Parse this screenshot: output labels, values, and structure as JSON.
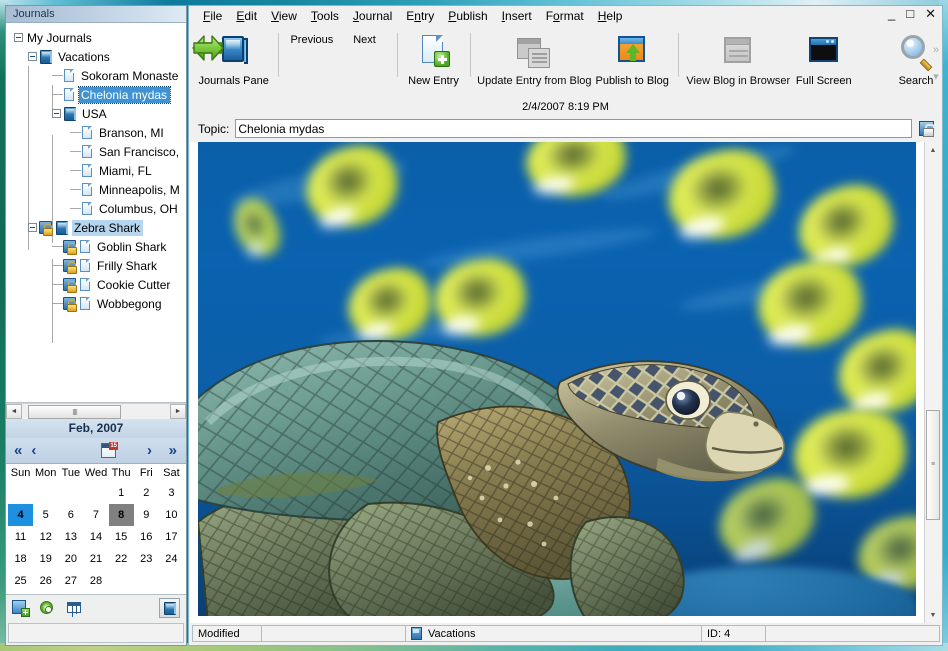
{
  "window": {
    "controls": {
      "minimize": "_",
      "maximize": "□",
      "close": "✕"
    }
  },
  "journals_pane": {
    "header": "Journals",
    "tree": [
      {
        "label": "My Journals",
        "depth": 0,
        "type": "root",
        "expander": "minus",
        "icon": "none",
        "locked": false,
        "selected": false
      },
      {
        "label": "Vacations",
        "depth": 1,
        "type": "journal",
        "expander": "minus",
        "icon": "book-icon",
        "locked": false,
        "selected": false
      },
      {
        "label": "Sokoram Monaste",
        "depth": 2,
        "type": "entry",
        "expander": "none",
        "icon": "page-icon",
        "locked": false,
        "selected": false
      },
      {
        "label": "Chelonia mydas",
        "depth": 2,
        "type": "entry",
        "expander": "none",
        "icon": "page-icon",
        "locked": false,
        "selected": true
      },
      {
        "label": "USA",
        "depth": 2,
        "type": "journal",
        "expander": "minus",
        "icon": "book-icon",
        "locked": false,
        "selected": false
      },
      {
        "label": "Branson, MI",
        "depth": 3,
        "type": "entry",
        "expander": "none",
        "icon": "page-icon",
        "locked": false,
        "selected": false
      },
      {
        "label": "San Francisco,",
        "depth": 3,
        "type": "entry",
        "expander": "none",
        "icon": "page-icon",
        "locked": false,
        "selected": false
      },
      {
        "label": "Miami, FL",
        "depth": 3,
        "type": "entry",
        "expander": "none",
        "icon": "page-icon",
        "locked": false,
        "selected": false
      },
      {
        "label": "Minneapolis, M",
        "depth": 3,
        "type": "entry",
        "expander": "none",
        "icon": "page-icon",
        "locked": false,
        "selected": false
      },
      {
        "label": "Columbus, OH",
        "depth": 3,
        "type": "entry",
        "expander": "none",
        "icon": "page-icon",
        "locked": false,
        "selected": false
      },
      {
        "label": "Zebra Shark",
        "depth": 1,
        "type": "journal",
        "expander": "minus",
        "icon": "book-icon",
        "locked": true,
        "selected": "soft"
      },
      {
        "label": "Goblin Shark",
        "depth": 2,
        "type": "entry",
        "expander": "none",
        "icon": "page-icon",
        "locked": true,
        "selected": false
      },
      {
        "label": "Frilly Shark",
        "depth": 2,
        "type": "entry",
        "expander": "none",
        "icon": "page-icon",
        "locked": true,
        "selected": false
      },
      {
        "label": "Cookie Cutter",
        "depth": 2,
        "type": "entry",
        "expander": "none",
        "icon": "page-icon",
        "locked": true,
        "selected": false
      },
      {
        "label": "Wobbegong",
        "depth": 2,
        "type": "entry",
        "expander": "none",
        "icon": "page-icon",
        "locked": true,
        "selected": false
      }
    ],
    "hscroll": {
      "left_arrow": "◄",
      "right_arrow": "►",
      "grip": "‖‖"
    }
  },
  "calendar": {
    "month_label": "Feb, 2007",
    "nav": {
      "prev_year": "«",
      "prev_month": "‹",
      "today_badge": "15",
      "next_month": "›",
      "next_year": "»"
    },
    "weekdays": [
      "Sun",
      "Mon",
      "Tue",
      "Wed",
      "Thu",
      "Fri",
      "Sat"
    ],
    "weeks": [
      [
        "",
        "",
        "",
        "",
        "1",
        "2",
        "3"
      ],
      [
        "4",
        "5",
        "6",
        "7",
        "8",
        "9",
        "10"
      ],
      [
        "11",
        "12",
        "13",
        "14",
        "15",
        "16",
        "17"
      ],
      [
        "18",
        "19",
        "20",
        "21",
        "22",
        "23",
        "24"
      ],
      [
        "25",
        "26",
        "27",
        "28",
        "",
        "",
        ""
      ]
    ],
    "selected_day": "4",
    "today_day": "8",
    "toolbar_icons": [
      "new-journal-icon",
      "settings-gear-icon",
      "grid-view-icon",
      "journals-pane-toggle-icon"
    ]
  },
  "menubar": [
    {
      "label": "File",
      "accel": "F"
    },
    {
      "label": "Edit",
      "accel": "E"
    },
    {
      "label": "View",
      "accel": "V"
    },
    {
      "label": "Tools",
      "accel": "T"
    },
    {
      "label": "Journal",
      "accel": "J"
    },
    {
      "label": "Entry",
      "accel": "n"
    },
    {
      "label": "Publish",
      "accel": "P"
    },
    {
      "label": "Insert",
      "accel": "I"
    },
    {
      "label": "Format",
      "accel": "o"
    },
    {
      "label": "Help",
      "accel": "H"
    }
  ],
  "toolbar": {
    "buttons": [
      {
        "label": "Journals Pane",
        "icon": "journals-pane-icon",
        "enabled": true
      },
      {
        "label": "Previous",
        "icon": "arrow-left-icon",
        "enabled": true
      },
      {
        "label": "Next",
        "icon": "arrow-right-icon",
        "enabled": true
      },
      {
        "label": "New Entry",
        "icon": "new-entry-icon",
        "enabled": true
      },
      {
        "label": "Update Entry from Blog",
        "icon": "update-from-blog-icon",
        "enabled": false
      },
      {
        "label": "Publish to Blog",
        "icon": "publish-to-blog-icon",
        "enabled": true
      },
      {
        "label": "View Blog in Browser",
        "icon": "view-blog-icon",
        "enabled": false
      },
      {
        "label": "Full Screen",
        "icon": "full-screen-icon",
        "enabled": true
      },
      {
        "label": "Search",
        "icon": "search-icon",
        "enabled": true
      }
    ],
    "overflow": {
      "chevrons": "»",
      "dropdown": "▾"
    }
  },
  "entry": {
    "date": "2/4/2007 8:19 PM",
    "topic_label": "Topic:",
    "topic_value": "Chelonia mydas",
    "topic_placeholder": "",
    "lock_icon": "entry-lock-icon"
  },
  "content": {
    "image_alt": "Green sea turtle (Chelonia mydas) swimming underwater with yellow butterflyfish",
    "vscroll": {
      "up_arrow": "▲",
      "down_arrow": "▼"
    }
  },
  "statusbar": {
    "modified": "Modified",
    "blank1": "",
    "journal_name": "Vacations",
    "journal_icon": "book-icon",
    "id": "ID: 4",
    "blank2": ""
  },
  "colors": {
    "frame_teal": "#2aa6c4",
    "frame_green": "#a9c67a",
    "selection_blue": "#3f93d4",
    "soft_selection": "#b6d5ef",
    "today_gray": "#808080",
    "cal_selected": "#1e90e0",
    "panel_bg": "#f0f0f0",
    "header_blue": "#b7cade"
  }
}
